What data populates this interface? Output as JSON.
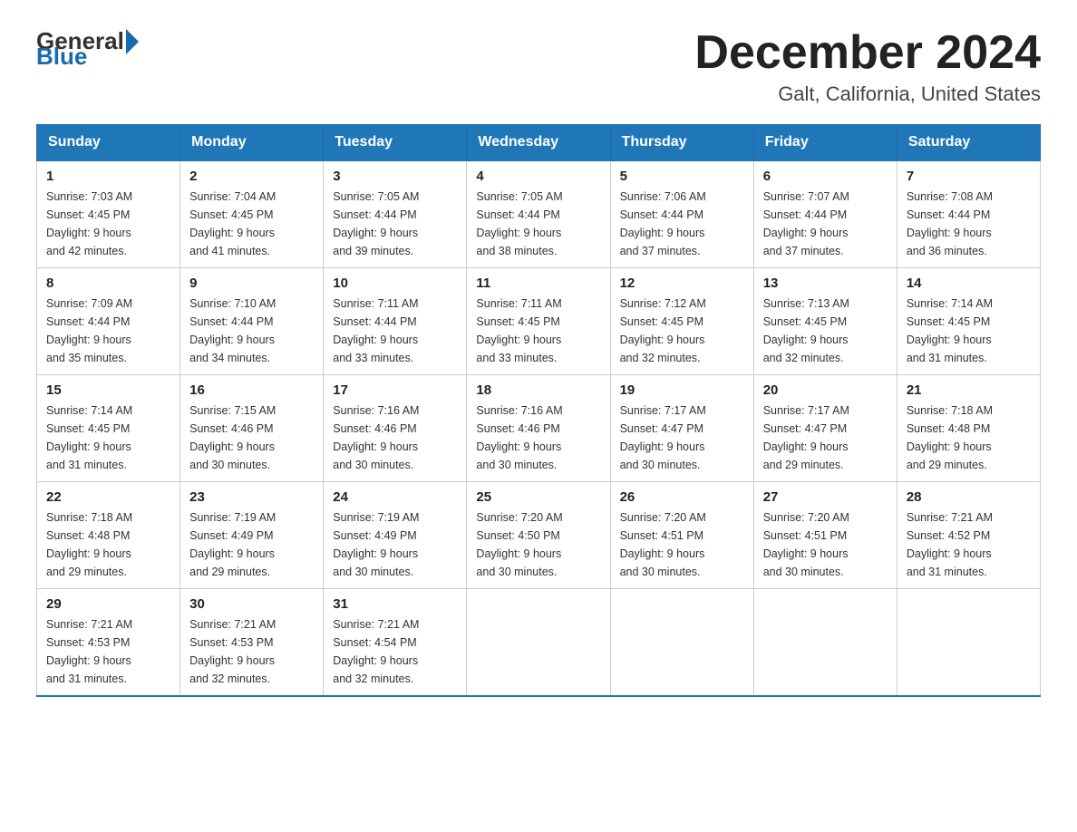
{
  "logo": {
    "general": "General",
    "blue": "Blue"
  },
  "header": {
    "month_title": "December 2024",
    "location": "Galt, California, United States"
  },
  "days_of_week": [
    "Sunday",
    "Monday",
    "Tuesday",
    "Wednesday",
    "Thursday",
    "Friday",
    "Saturday"
  ],
  "weeks": [
    [
      {
        "day": "1",
        "sunrise": "7:03 AM",
        "sunset": "4:45 PM",
        "daylight": "9 hours and 42 minutes."
      },
      {
        "day": "2",
        "sunrise": "7:04 AM",
        "sunset": "4:45 PM",
        "daylight": "9 hours and 41 minutes."
      },
      {
        "day": "3",
        "sunrise": "7:05 AM",
        "sunset": "4:44 PM",
        "daylight": "9 hours and 39 minutes."
      },
      {
        "day": "4",
        "sunrise": "7:05 AM",
        "sunset": "4:44 PM",
        "daylight": "9 hours and 38 minutes."
      },
      {
        "day": "5",
        "sunrise": "7:06 AM",
        "sunset": "4:44 PM",
        "daylight": "9 hours and 37 minutes."
      },
      {
        "day": "6",
        "sunrise": "7:07 AM",
        "sunset": "4:44 PM",
        "daylight": "9 hours and 37 minutes."
      },
      {
        "day": "7",
        "sunrise": "7:08 AM",
        "sunset": "4:44 PM",
        "daylight": "9 hours and 36 minutes."
      }
    ],
    [
      {
        "day": "8",
        "sunrise": "7:09 AM",
        "sunset": "4:44 PM",
        "daylight": "9 hours and 35 minutes."
      },
      {
        "day": "9",
        "sunrise": "7:10 AM",
        "sunset": "4:44 PM",
        "daylight": "9 hours and 34 minutes."
      },
      {
        "day": "10",
        "sunrise": "7:11 AM",
        "sunset": "4:44 PM",
        "daylight": "9 hours and 33 minutes."
      },
      {
        "day": "11",
        "sunrise": "7:11 AM",
        "sunset": "4:45 PM",
        "daylight": "9 hours and 33 minutes."
      },
      {
        "day": "12",
        "sunrise": "7:12 AM",
        "sunset": "4:45 PM",
        "daylight": "9 hours and 32 minutes."
      },
      {
        "day": "13",
        "sunrise": "7:13 AM",
        "sunset": "4:45 PM",
        "daylight": "9 hours and 32 minutes."
      },
      {
        "day": "14",
        "sunrise": "7:14 AM",
        "sunset": "4:45 PM",
        "daylight": "9 hours and 31 minutes."
      }
    ],
    [
      {
        "day": "15",
        "sunrise": "7:14 AM",
        "sunset": "4:45 PM",
        "daylight": "9 hours and 31 minutes."
      },
      {
        "day": "16",
        "sunrise": "7:15 AM",
        "sunset": "4:46 PM",
        "daylight": "9 hours and 30 minutes."
      },
      {
        "day": "17",
        "sunrise": "7:16 AM",
        "sunset": "4:46 PM",
        "daylight": "9 hours and 30 minutes."
      },
      {
        "day": "18",
        "sunrise": "7:16 AM",
        "sunset": "4:46 PM",
        "daylight": "9 hours and 30 minutes."
      },
      {
        "day": "19",
        "sunrise": "7:17 AM",
        "sunset": "4:47 PM",
        "daylight": "9 hours and 30 minutes."
      },
      {
        "day": "20",
        "sunrise": "7:17 AM",
        "sunset": "4:47 PM",
        "daylight": "9 hours and 29 minutes."
      },
      {
        "day": "21",
        "sunrise": "7:18 AM",
        "sunset": "4:48 PM",
        "daylight": "9 hours and 29 minutes."
      }
    ],
    [
      {
        "day": "22",
        "sunrise": "7:18 AM",
        "sunset": "4:48 PM",
        "daylight": "9 hours and 29 minutes."
      },
      {
        "day": "23",
        "sunrise": "7:19 AM",
        "sunset": "4:49 PM",
        "daylight": "9 hours and 29 minutes."
      },
      {
        "day": "24",
        "sunrise": "7:19 AM",
        "sunset": "4:49 PM",
        "daylight": "9 hours and 30 minutes."
      },
      {
        "day": "25",
        "sunrise": "7:20 AM",
        "sunset": "4:50 PM",
        "daylight": "9 hours and 30 minutes."
      },
      {
        "day": "26",
        "sunrise": "7:20 AM",
        "sunset": "4:51 PM",
        "daylight": "9 hours and 30 minutes."
      },
      {
        "day": "27",
        "sunrise": "7:20 AM",
        "sunset": "4:51 PM",
        "daylight": "9 hours and 30 minutes."
      },
      {
        "day": "28",
        "sunrise": "7:21 AM",
        "sunset": "4:52 PM",
        "daylight": "9 hours and 31 minutes."
      }
    ],
    [
      {
        "day": "29",
        "sunrise": "7:21 AM",
        "sunset": "4:53 PM",
        "daylight": "9 hours and 31 minutes."
      },
      {
        "day": "30",
        "sunrise": "7:21 AM",
        "sunset": "4:53 PM",
        "daylight": "9 hours and 32 minutes."
      },
      {
        "day": "31",
        "sunrise": "7:21 AM",
        "sunset": "4:54 PM",
        "daylight": "9 hours and 32 minutes."
      },
      null,
      null,
      null,
      null
    ]
  ]
}
